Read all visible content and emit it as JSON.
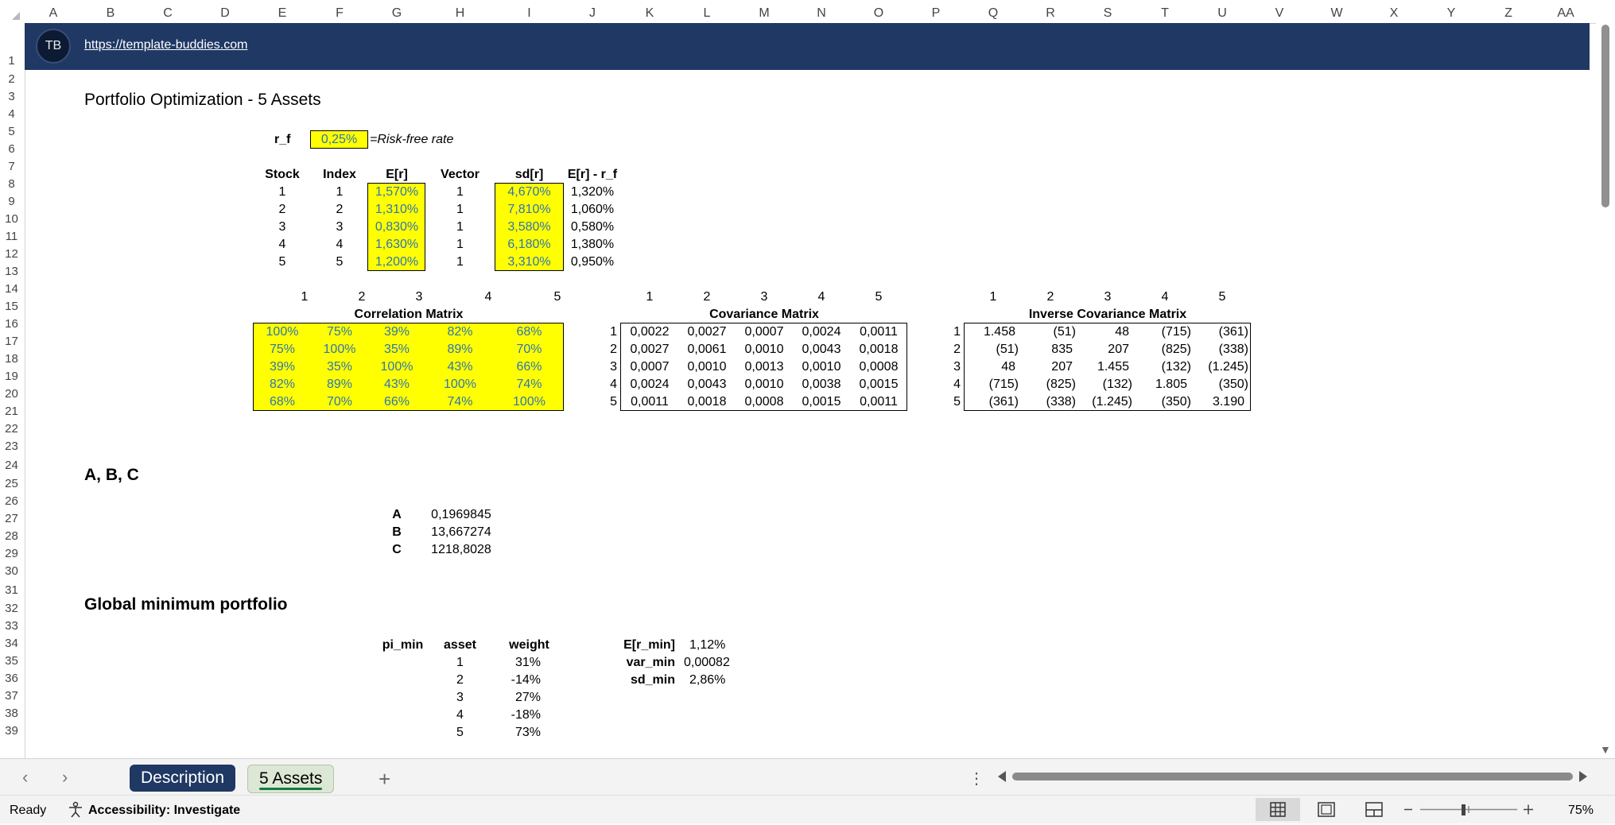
{
  "columns": [
    "A",
    "B",
    "C",
    "D",
    "E",
    "F",
    "G",
    "H",
    "I",
    "J",
    "K",
    "L",
    "M",
    "N",
    "O",
    "P",
    "Q",
    "R",
    "S",
    "T",
    "U",
    "V",
    "W",
    "X",
    "Y",
    "Z",
    "AA"
  ],
  "rows": [
    "1",
    "2",
    "3",
    "4",
    "5",
    "6",
    "7",
    "8",
    "9",
    "10",
    "11",
    "12",
    "13",
    "14",
    "15",
    "16",
    "17",
    "18",
    "19",
    "20",
    "21",
    "22",
    "23",
    "24",
    "25",
    "26",
    "27",
    "28",
    "29",
    "30",
    "31",
    "32",
    "33",
    "34",
    "35",
    "36",
    "37",
    "38",
    "39"
  ],
  "banner": {
    "link": "https://template-buddies.com",
    "logo_text": "TB",
    "logo_icon": "scales-logo-icon",
    "color": "#1f3864"
  },
  "title": "Portfolio Optimization - 5 Assets",
  "risk_free": {
    "label": "r_f",
    "value": "0,25%",
    "note": "=Risk-free rate"
  },
  "assets_table": {
    "headers": [
      "Stock",
      "Index",
      "E[r]",
      "Vector",
      "sd[r]",
      "E[r] - r_f"
    ],
    "rows": [
      [
        "1",
        "1",
        "1,570%",
        "1",
        "4,670%",
        "1,320%"
      ],
      [
        "2",
        "2",
        "1,310%",
        "1",
        "7,810%",
        "1,060%"
      ],
      [
        "3",
        "3",
        "0,830%",
        "1",
        "3,580%",
        "0,580%"
      ],
      [
        "4",
        "4",
        "1,630%",
        "1",
        "6,180%",
        "1,380%"
      ],
      [
        "5",
        "5",
        "1,200%",
        "1",
        "3,310%",
        "0,950%"
      ]
    ]
  },
  "correlation": {
    "title": "Correlation Matrix",
    "col_headers": [
      "1",
      "2",
      "3",
      "4",
      "5"
    ],
    "rows": [
      [
        "100%",
        "75%",
        "39%",
        "82%",
        "68%"
      ],
      [
        "75%",
        "100%",
        "35%",
        "89%",
        "70%"
      ],
      [
        "39%",
        "35%",
        "100%",
        "43%",
        "66%"
      ],
      [
        "82%",
        "89%",
        "43%",
        "100%",
        "74%"
      ],
      [
        "68%",
        "70%",
        "66%",
        "74%",
        "100%"
      ]
    ]
  },
  "covariance": {
    "title": "Covariance Matrix",
    "col_headers": [
      "1",
      "2",
      "3",
      "4",
      "5"
    ],
    "row_headers": [
      "1",
      "2",
      "3",
      "4",
      "5"
    ],
    "rows": [
      [
        "0,0022",
        "0,0027",
        "0,0007",
        "0,0024",
        "0,0011"
      ],
      [
        "0,0027",
        "0,0061",
        "0,0010",
        "0,0043",
        "0,0018"
      ],
      [
        "0,0007",
        "0,0010",
        "0,0013",
        "0,0010",
        "0,0008"
      ],
      [
        "0,0024",
        "0,0043",
        "0,0010",
        "0,0038",
        "0,0015"
      ],
      [
        "0,0011",
        "0,0018",
        "0,0008",
        "0,0015",
        "0,0011"
      ]
    ]
  },
  "inverse": {
    "title": "Inverse Covariance Matrix",
    "col_headers": [
      "1",
      "2",
      "3",
      "4",
      "5"
    ],
    "row_headers": [
      "1",
      "2",
      "3",
      "4",
      "5"
    ],
    "rows": [
      [
        "1.458",
        "(51)",
        "48",
        "(715)",
        "(361)"
      ],
      [
        "(51)",
        "835",
        "207",
        "(825)",
        "(338)"
      ],
      [
        "48",
        "207",
        "1.455",
        "(132)",
        "(1.245)"
      ],
      [
        "(715)",
        "(825)",
        "(132)",
        "1.805",
        "(350)"
      ],
      [
        "(361)",
        "(338)",
        "(1.245)",
        "(350)",
        "3.190"
      ]
    ]
  },
  "abc": {
    "heading": "A, B, C",
    "items": [
      {
        "label": "A",
        "value": "0,1969845"
      },
      {
        "label": "B",
        "value": "13,667274"
      },
      {
        "label": "C",
        "value": "1218,8028"
      }
    ]
  },
  "gmp": {
    "heading": "Global minimum portfolio",
    "label": "pi_min",
    "headers": [
      "asset",
      "weight"
    ],
    "rows": [
      [
        "1",
        "31%"
      ],
      [
        "2",
        "-14%"
      ],
      [
        "3",
        "27%"
      ],
      [
        "4",
        "-18%"
      ],
      [
        "5",
        "73%"
      ]
    ],
    "stats": [
      {
        "label": "E[r_min]",
        "value": "1,12%"
      },
      {
        "label": "var_min",
        "value": "0,00082"
      },
      {
        "label": "sd_min",
        "value": "2,86%"
      }
    ]
  },
  "tabs": [
    {
      "label": "Description",
      "state": "active"
    },
    {
      "label": "5 Assets",
      "state": "selected"
    }
  ],
  "status": {
    "ready": "Ready",
    "accessibility": "Accessibility: Investigate",
    "zoom": "75%"
  },
  "colors": {
    "input_fill": "#ffff00",
    "input_text": "#2e75b6",
    "accent_green": "#107c41"
  }
}
